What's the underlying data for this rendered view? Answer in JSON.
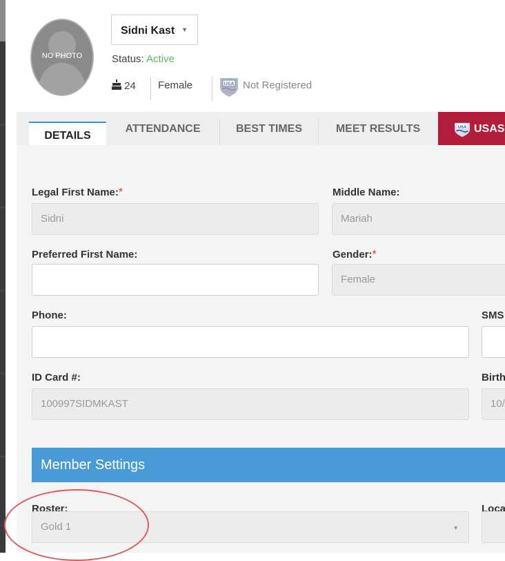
{
  "profile": {
    "avatar_text": "NO PHOTO",
    "name": "Sidni Kast",
    "status_label": "Status:",
    "status_value": "Active",
    "age_icon": "birthday-cake-icon",
    "age": "24",
    "gender": "Female",
    "registration_badge": "usa-swimming-badge-icon",
    "registration_status": "Not Registered"
  },
  "tabs": [
    {
      "label": "DETAILS",
      "active": true
    },
    {
      "label": "ATTENDANCE"
    },
    {
      "label": "BEST TIMES"
    },
    {
      "label": "MEET RESULTS"
    },
    {
      "label": "USAS"
    }
  ],
  "form": {
    "legal_first_name": {
      "label": "Legal First Name:",
      "value": "Sidni",
      "required": true
    },
    "middle_name": {
      "label": "Middle Name:",
      "value": "Mariah"
    },
    "preferred_first_name": {
      "label": "Preferred First Name:",
      "value": ""
    },
    "gender": {
      "label": "Gender:",
      "value": "Female",
      "required": true
    },
    "phone": {
      "label": "Phone:",
      "value": ""
    },
    "sms": {
      "label": "SMS"
    },
    "id_card": {
      "label": "ID Card #:",
      "value": "100997SIDMKAST"
    },
    "birth": {
      "label": "Birth",
      "value": "10/"
    }
  },
  "member_settings": {
    "title": "Member Settings",
    "roster": {
      "label": "Roster:",
      "value": "Gold 1"
    },
    "location": {
      "label": "Loca"
    }
  },
  "colors": {
    "accent": "#4a9ad8",
    "active_status": "#5cb85c",
    "usas_tab": "#b21d3b",
    "required": "#e03131",
    "annotation": "#e05a5a"
  }
}
